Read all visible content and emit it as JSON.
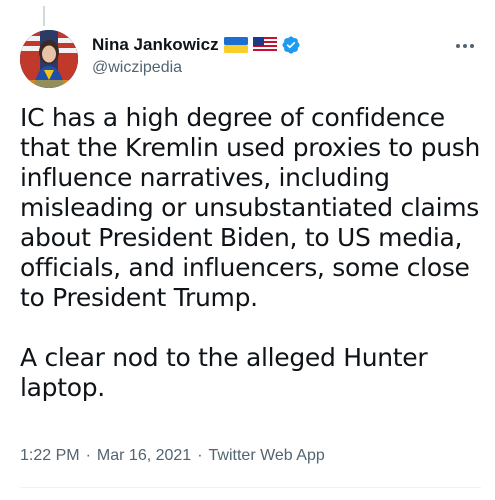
{
  "tweet": {
    "author": {
      "display_name": "Nina Jankowicz",
      "handle": "@wiczipedia",
      "flags": [
        "ukraine-flag-emoji",
        "us-flag-emoji"
      ],
      "verified": true
    },
    "paragraphs": [
      "IC has a high degree of confidence that the Kremlin used proxies to push influence narratives, including misleading or unsubstantiated claims about President Biden, to US media, officials, and influencers, some close to President Trump.",
      "A clear nod to the alleged Hunter laptop."
    ],
    "time": "1:22 PM",
    "date": "Mar 16, 2021",
    "source": "Twitter Web App",
    "separator": "·"
  },
  "icons": {
    "more": "more-horizontal-icon",
    "verified": "verified-badge-icon"
  },
  "colors": {
    "text_primary": "#0f1419",
    "text_secondary": "#536471",
    "verified_blue": "#1d9bf0",
    "divider": "#eff3f4"
  }
}
